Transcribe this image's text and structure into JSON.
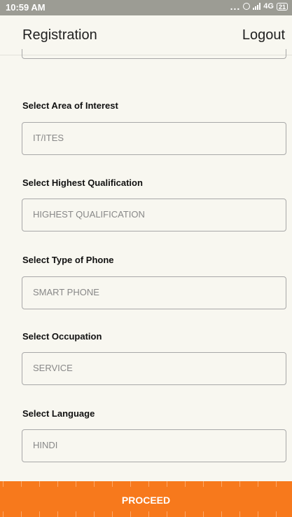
{
  "status_bar": {
    "time": "10:59 AM",
    "dots": "...",
    "network": "4G",
    "battery": "21"
  },
  "header": {
    "title": "Registration",
    "logout_label": "Logout"
  },
  "form": {
    "area": {
      "label": "Select Area of Interest",
      "value": "IT/ITES"
    },
    "qualification": {
      "label": "Select Highest Qualification",
      "value": "HIGHEST QUALIFICATION"
    },
    "phone": {
      "label": "Select Type of Phone",
      "value": "SMART PHONE"
    },
    "occupation": {
      "label": "Select Occupation",
      "value": "SERVICE"
    },
    "language": {
      "label": "Select Language",
      "value": "HINDI"
    }
  },
  "proceed_label": "PROCEED",
  "colors": {
    "accent": "#f7791c",
    "status_bar": "#9c9c94",
    "background": "#f8f7f0"
  }
}
